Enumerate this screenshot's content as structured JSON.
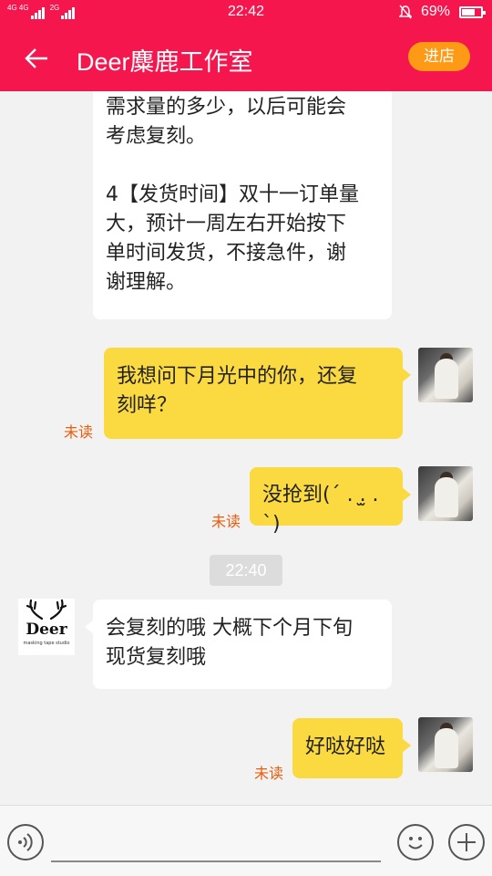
{
  "status_bar": {
    "network_left": "4G 4G",
    "network_right": "2G",
    "time": "22:42",
    "battery": "69%"
  },
  "header": {
    "title": "Deer麋鹿工作室",
    "store_button": "进店"
  },
  "messages": {
    "shop_msg_1": {
      "lines": [
        "需求量的多少，以后可能会",
        "考虑复刻。",
        "",
        "4【发货时间】双十一订单量",
        "大，预计一周左右开始按下",
        "单时间发货，不接急件，谢",
        "谢理解。"
      ]
    },
    "user_msg_1": {
      "lines": [
        "我想问下月光中的你，还复",
        "刻咩？"
      ],
      "status": "未读"
    },
    "user_msg_2": {
      "text": "没抢到(´ . .̫ . `)",
      "status": "未读"
    },
    "timestamp": "22:40",
    "shop_msg_2": {
      "lines": [
        "会复刻的哦 大概下个月下旬",
        "现货复刻哦"
      ]
    },
    "user_msg_3": {
      "text": "好哒好哒",
      "status": "未读"
    }
  },
  "shop_avatar": {
    "name": "Deer",
    "subtitle": "masking tape studio"
  },
  "colors": {
    "header": "#f5164e",
    "store_button": "#ff9a16",
    "outgoing_bubble": "#fbd940",
    "unread": "#e85d0c"
  }
}
